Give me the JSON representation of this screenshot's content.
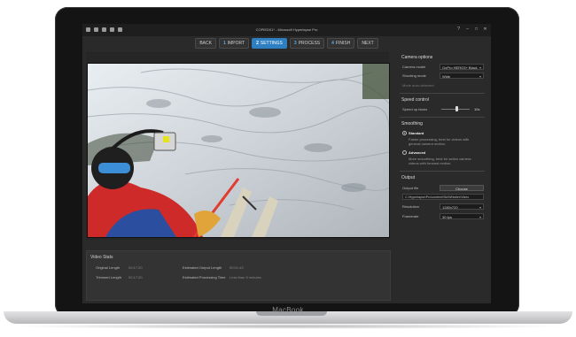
{
  "window": {
    "title": "COPIED01* - Microsoft Hyperlapse Pro",
    "controls": [
      "?",
      "–",
      "□",
      "✕"
    ]
  },
  "wizard": {
    "back": "BACK",
    "steps": [
      {
        "num": "1",
        "label": "IMPORT"
      },
      {
        "num": "2",
        "label": "SETTINGS"
      },
      {
        "num": "3",
        "label": "PROCESS"
      },
      {
        "num": "4",
        "label": "FINISH"
      }
    ],
    "next": "NEXT",
    "active_step": 2
  },
  "video_stats": {
    "heading": "Video Stats",
    "original_length_label": "Original Length",
    "original_length_value": "00:17:20",
    "trimmed_length_label": "Trimmed Length",
    "trimmed_length_value": "00:17:20",
    "est_output_label": "Estimated Output Length",
    "est_output_value": "00:01:43",
    "est_processing_label": "Estimated Processing Time",
    "est_processing_value": "Less than 5 minutes"
  },
  "camera_options": {
    "heading": "Camera options",
    "model_label": "Camera model",
    "model_value": "GoPro HERO3+ Black",
    "mode_label": "Shooting mode",
    "mode_value": "Wide",
    "mode_hint": "Mode auto-detected"
  },
  "speed_control": {
    "heading": "Speed control",
    "factor_label": "Speed up factor",
    "factor_value": "10x",
    "slider_fraction": 0.55
  },
  "smoothing": {
    "heading": "Smoothing",
    "options": [
      {
        "label": "Standard",
        "desc": "Faster processing, best for videos with general camera motion.",
        "selected": true
      },
      {
        "label": "Advanced",
        "desc": "More smoothing, best for action camera videos with forward motion.",
        "selected": false
      }
    ]
  },
  "output": {
    "heading": "Output",
    "file_label": "Output file",
    "choose_label": "Choose",
    "path_value": "C:\\Hyperlapse\\Pro\\content\\Ski\\Whistler\\Video",
    "resolution_label": "Resolution",
    "resolution_value": "1280x720",
    "framerate_label": "Framerate",
    "framerate_value": "30 fps"
  },
  "device": {
    "brand": "MacBook"
  },
  "colors": {
    "accent": "#2d7fc1",
    "panel": "#2a2a2a"
  }
}
